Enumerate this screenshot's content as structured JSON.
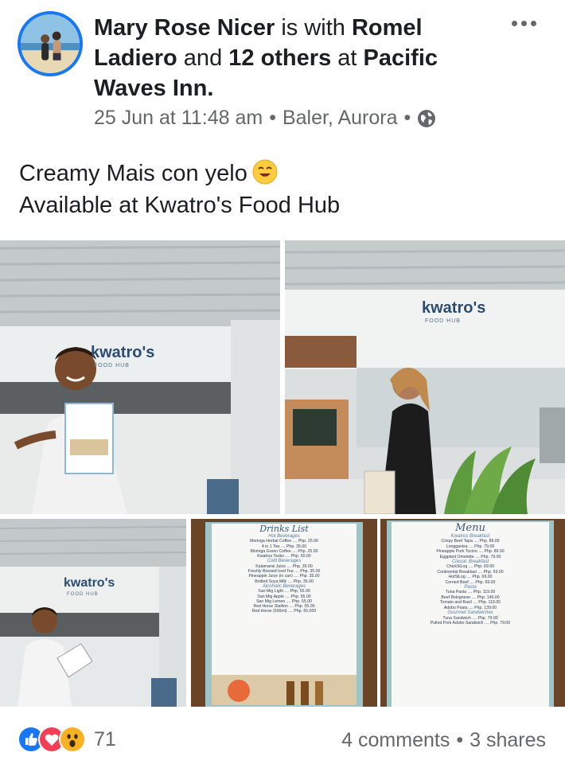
{
  "post": {
    "author": "Mary Rose Nicer",
    "with_text": " is with ",
    "tagged_person": "Romel Ladiero",
    "and_text": " and ",
    "others": "12 others",
    "at_text": " at ",
    "place": "Pacific Waves Inn.",
    "date": "25 Jun at 11:48 am",
    "location": "Baler, Aurora",
    "privacy_icon": "globe-icon",
    "more_icon": "more-options-icon",
    "line1": "Creamy Mais con yelo",
    "line1_emoji": "smiling-face-emoji",
    "line2": "Available at Kwatro's Food Hub"
  },
  "photos": [
    {
      "name": "photo-man-holding-menu",
      "sign_text": "kwatro's",
      "sign_sub": "FOOD    HUB"
    },
    {
      "name": "photo-woman-at-counter",
      "sign_text": "kwatro's",
      "sign_sub": "FOOD    HUB"
    },
    {
      "name": "photo-man-with-menu-small",
      "sign_text": "kwatro's",
      "sign_sub": "FOOD    HUB"
    },
    {
      "name": "photo-drinks-list-menu",
      "menu_title": "Drinks List",
      "section1": "Hot Beverages",
      "section2": "Cold Beverages",
      "section3": "Alcoholic Beverages"
    },
    {
      "name": "photo-food-menu",
      "menu_title": "Menu",
      "section1": "Kwatros Breakfast",
      "section2": "Classic Breakfast",
      "section3": "Pasta",
      "section4": "Gourmet Sandwiches"
    }
  ],
  "menu_items": {
    "drinks": [
      "Moringa Herbal Coffee .... Php. 25.00",
      "4 in 1 Tea .... Php. 35.00",
      "Moringa Green Coffee .... Php. 25.00",
      "Kwatros Tsoko .... Php. 50.00",
      "Kalamansi Juice .... Php. 35.00",
      "Freshly Brewed Iced Tea .... Php. 35.00",
      "Pineapple Juice (in can) .... Php. 35.00",
      "Bottled Soya Milk .... Php. 35.00",
      "San Mig Light .... Php. 55.00",
      "San Mig Apple .... Php. 55.00",
      "San Mig Lemon .... Php. 55.00",
      "Red Horse Stallion .... Php. 55.00",
      "Red Horse (500ml) .... Php. 65.000"
    ],
    "food": [
      "Crispy Beef Tapa .... Php. 89.00",
      "Longganisa .... Php. 79.00",
      "Pineapple Pork Tocino .... Php. 89.00",
      "Eggplant Omelette .... Php. 79.00",
      "ChickSiLog .... Php. 69.00",
      "Continental Breakfast .... Php. 59.00",
      "HotSiLog .... Php. 69.00",
      "Corned Beef .... Php. 69.00",
      "Tuna Pasta .... Php. 119.00",
      "Beef Bolognese .... Php. 149.00",
      "Tomato and Basil .... Php. 119.00",
      "Adobo Pasta .... Php. 139.00",
      "Tuna Sandwich .... Php. 79.00",
      "Pulled Pork Adobo Sandwich .... Php. 79.00"
    ]
  },
  "footer": {
    "reaction_icons": [
      "like-reaction-icon",
      "love-reaction-icon",
      "wow-reaction-icon"
    ],
    "reaction_count": "71",
    "comments": "4 comments",
    "separator": "•",
    "shares": "3 shares"
  },
  "colors": {
    "accent_blue": "#1877f2",
    "love_red": "#f33e58",
    "wow_yellow": "#f7b125",
    "meta_gray": "#65676b",
    "text_dark": "#1c1e21"
  }
}
